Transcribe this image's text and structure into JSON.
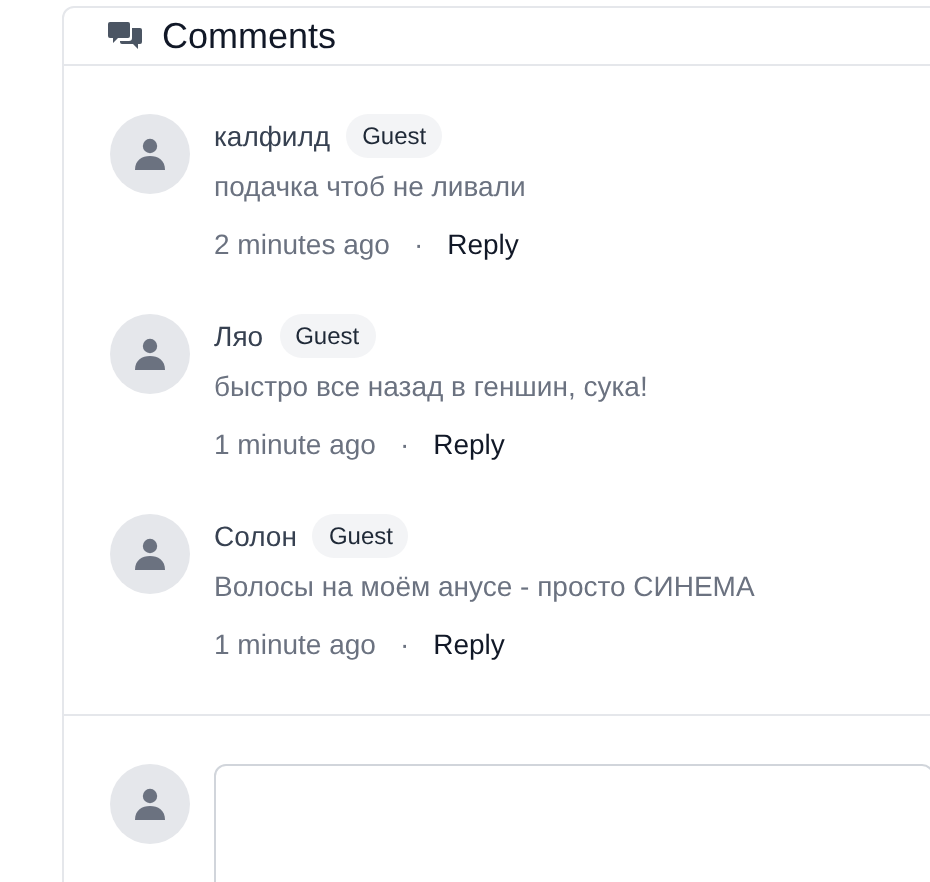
{
  "header": {
    "title": "Comments"
  },
  "comments": [
    {
      "author": "калфилд",
      "badge": "Guest",
      "text": "подачка чтоб не ливали",
      "time": "2 minutes ago",
      "separator": "·",
      "action": "Reply"
    },
    {
      "author": "Ляо",
      "badge": "Guest",
      "text": "быстро все назад в геншин, сука!",
      "time": "1 minute ago",
      "separator": "·",
      "action": "Reply"
    },
    {
      "author": "Солон",
      "badge": "Guest",
      "text": "Волосы на моём анусе - просто СИНЕМА",
      "time": "1 minute ago",
      "separator": "·",
      "action": "Reply"
    }
  ]
}
